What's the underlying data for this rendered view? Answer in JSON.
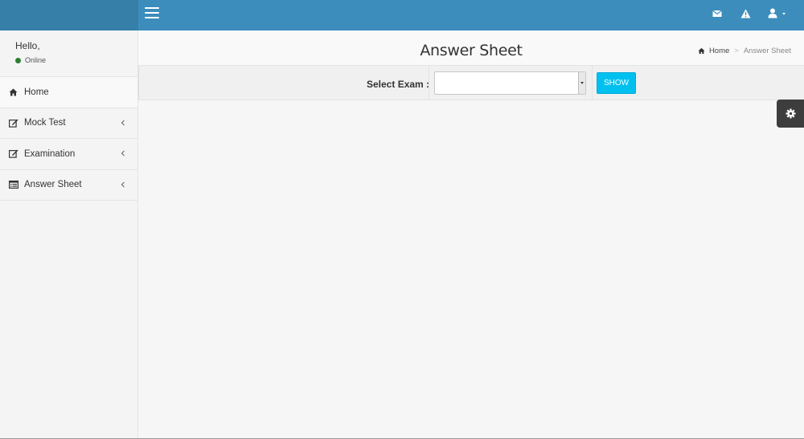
{
  "header": {
    "menu_icon": "hamburger-menu-icon",
    "icons": [
      "envelope-icon",
      "warning-icon",
      "user-icon"
    ]
  },
  "sidebar": {
    "greeting": "Hello,",
    "status": "Online",
    "status_color": "#2e7d32",
    "items": [
      {
        "label": "Home",
        "icon": "home-icon"
      },
      {
        "label": "Mock Test",
        "icon": "edit-icon"
      },
      {
        "label": "Examination",
        "icon": "edit-icon"
      },
      {
        "label": "Answer Sheet",
        "icon": "list-icon"
      }
    ]
  },
  "content": {
    "title": "Answer Sheet",
    "breadcrumb": {
      "home": "Home",
      "current": "Answer Sheet"
    }
  },
  "filter": {
    "label": "Select Exam :",
    "selected_value": "",
    "button_label": "SHOW"
  },
  "colors": {
    "header": "#3c8dbc",
    "header_logo": "#367fa9",
    "show_button": "#00c0ef",
    "settings_tab": "#3d3d3d"
  }
}
